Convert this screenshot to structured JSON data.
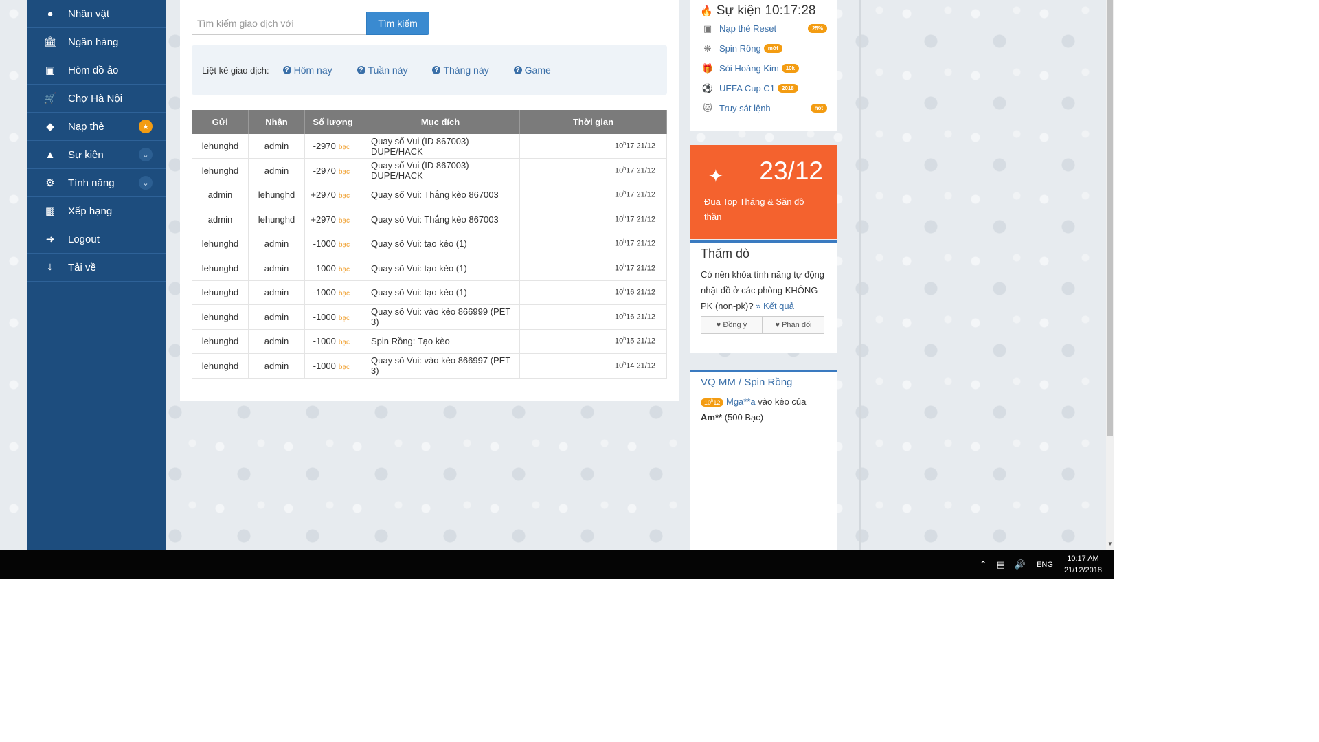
{
  "sidebar": {
    "items": [
      {
        "label": "Nhân vật",
        "icon": "user-icon"
      },
      {
        "label": "Ngân hàng",
        "icon": "bank-icon"
      },
      {
        "label": "Hòm đồ ảo",
        "icon": "briefcase-icon"
      },
      {
        "label": "Chợ Hà Nội",
        "icon": "cart-icon"
      },
      {
        "label": "Nạp thẻ",
        "icon": "diamond-icon",
        "badge": "star-icon"
      },
      {
        "label": "Sự kiện",
        "icon": "android-icon",
        "badge": "chevron-down-icon"
      },
      {
        "label": "Tính năng",
        "icon": "cogs-icon",
        "badge": "chevron-down-icon"
      },
      {
        "label": "Xếp hạng",
        "icon": "bar-chart-icon"
      },
      {
        "label": "Logout",
        "icon": "sign-out-icon"
      },
      {
        "label": "Tải về",
        "icon": "download-icon"
      }
    ]
  },
  "search": {
    "placeholder": "Tìm kiếm giao dịch với",
    "value": "",
    "button_label": "Tìm kiếm"
  },
  "filters": {
    "label": "Liệt kê giao dịch:",
    "links": [
      "Hôm nay",
      "Tuần này",
      "Tháng này",
      "Game"
    ]
  },
  "table": {
    "headers": [
      "Gửi",
      "Nhận",
      "Số lượng",
      "Mục đích",
      "Thời gian"
    ],
    "unit": "bạc",
    "rows": [
      {
        "send": "lehunghd",
        "recv": "admin",
        "amount": "-2970",
        "purpose": "Quay số Vui (ID 867003) DUPE/HACK",
        "hour": "10",
        "minute": "17",
        "date": "21/12"
      },
      {
        "send": "lehunghd",
        "recv": "admin",
        "amount": "-2970",
        "purpose": "Quay số Vui (ID 867003) DUPE/HACK",
        "hour": "10",
        "minute": "17",
        "date": "21/12"
      },
      {
        "send": "admin",
        "recv": "lehunghd",
        "amount": "+2970",
        "purpose": "Quay số Vui: Thắng kèo 867003",
        "hour": "10",
        "minute": "17",
        "date": "21/12"
      },
      {
        "send": "admin",
        "recv": "lehunghd",
        "amount": "+2970",
        "purpose": "Quay số Vui: Thắng kèo 867003",
        "hour": "10",
        "minute": "17",
        "date": "21/12"
      },
      {
        "send": "lehunghd",
        "recv": "admin",
        "amount": "-1000",
        "purpose": "Quay số Vui: tạo kèo (1)",
        "hour": "10",
        "minute": "17",
        "date": "21/12"
      },
      {
        "send": "lehunghd",
        "recv": "admin",
        "amount": "-1000",
        "purpose": "Quay số Vui: tạo kèo (1)",
        "hour": "10",
        "minute": "17",
        "date": "21/12"
      },
      {
        "send": "lehunghd",
        "recv": "admin",
        "amount": "-1000",
        "purpose": "Quay số Vui: tạo kèo (1)",
        "hour": "10",
        "minute": "16",
        "date": "21/12"
      },
      {
        "send": "lehunghd",
        "recv": "admin",
        "amount": "-1000",
        "purpose": "Quay số Vui: vào kèo 866999 (PET 3)",
        "hour": "10",
        "minute": "16",
        "date": "21/12"
      },
      {
        "send": "lehunghd",
        "recv": "admin",
        "amount": "-1000",
        "purpose": "Spin Rồng: Tạo kèo",
        "hour": "10",
        "minute": "15",
        "date": "21/12"
      },
      {
        "send": "lehunghd",
        "recv": "admin",
        "amount": "-1000",
        "purpose": "Quay số Vui: vào kèo 866997 (PET 3)",
        "hour": "10",
        "minute": "14",
        "date": "21/12"
      }
    ]
  },
  "events": {
    "title": "Sự kiện 10:17:28",
    "title_icon": "flame-icon",
    "items": [
      {
        "label": "Nạp thẻ Reset",
        "badge": "25%",
        "icon": "money-icon"
      },
      {
        "label": "Spin Rồng",
        "badge": "mới",
        "icon": "spinner-icon"
      },
      {
        "label": "Sói Hoàng Kim",
        "badge": "10k",
        "icon": "gift-icon"
      },
      {
        "label": "UEFA Cup C1",
        "badge": "2018",
        "icon": "soccer-ball-icon"
      },
      {
        "label": "Truy sát lệnh",
        "badge": "hot",
        "icon": "cat-icon"
      }
    ]
  },
  "promo": {
    "date": "23/12",
    "text": "Đua Top Tháng & Săn đồ thần",
    "icon": "fencer-icon",
    "bg_color": "#f4622e"
  },
  "poll": {
    "title": "Thăm dò",
    "question": "Có nên khóa tính năng tự động nhặt đồ ở các phòng KHÔNG PK (non-pk)?",
    "result_link": "» Kết quả",
    "agree_label": "Đồng ý",
    "disagree_label": "Phản đối"
  },
  "spin_log": {
    "title": "VQ MM / Spin Rồng",
    "entry": {
      "hour": "10",
      "minute": "h",
      "day": "12",
      "player": "Mga**a",
      "action": "vào kèo của",
      "target": "Am**",
      "amount": "(500 Bạc)"
    }
  },
  "taskbar": {
    "lang": "ENG",
    "time": "10:17 AM",
    "date": "21/12/2018"
  },
  "colors": {
    "sidebar": "#1d4d7e",
    "accent": "#3a8ad0",
    "orange": "#f39c12",
    "table_header": "#7b7b7b"
  }
}
